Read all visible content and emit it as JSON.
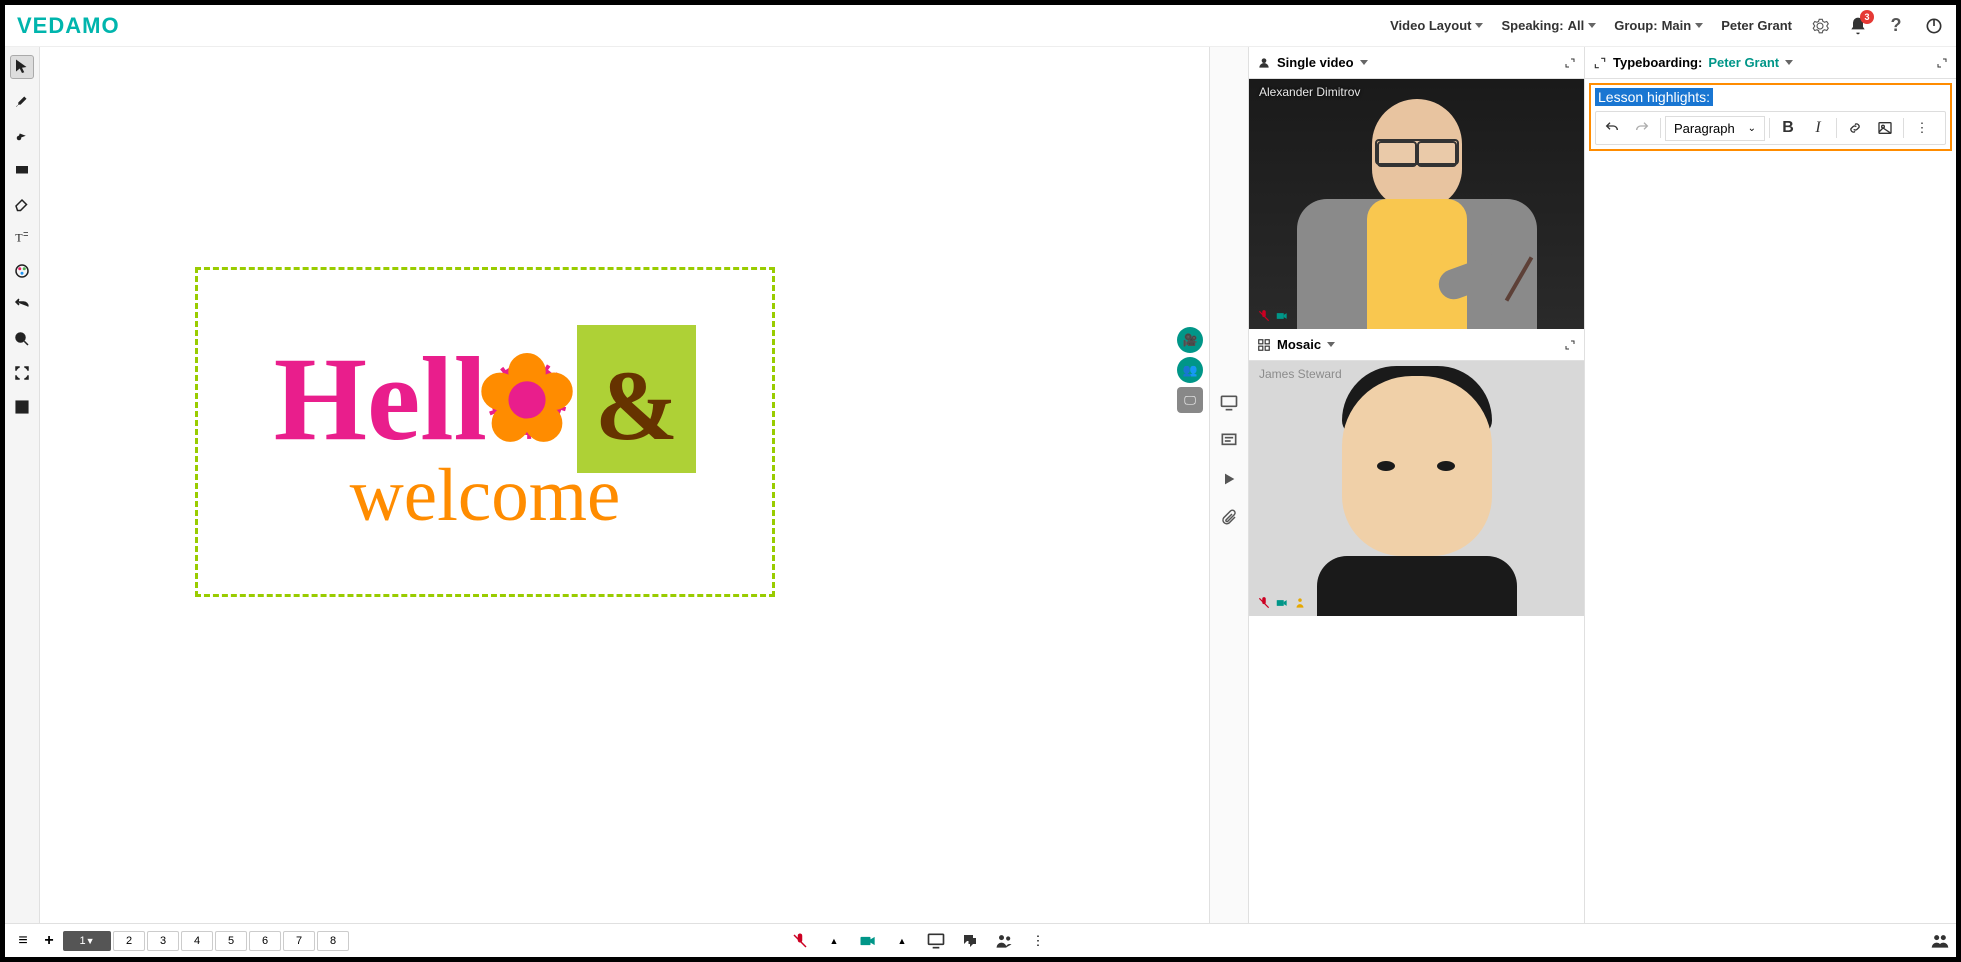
{
  "app": {
    "logo": "VEDAMO"
  },
  "header": {
    "video_layout": "Video Layout",
    "speaking_label": "Speaking:",
    "speaking_value": "All",
    "group_label": "Group:",
    "group_value": "Main",
    "user": "Peter Grant",
    "notification_count": "3"
  },
  "whiteboard": {
    "hello": "Hello",
    "amp": "&",
    "welcome": "welcome"
  },
  "pages": [
    "1",
    "2",
    "3",
    "4",
    "5",
    "6",
    "7",
    "8"
  ],
  "video": {
    "mode1_label": "Single video",
    "participant1": "Alexander Dimitrov",
    "mode2_label": "Mosaic",
    "participant2": "James Steward"
  },
  "typeboard": {
    "label": "Typeboarding:",
    "user": "Peter Grant",
    "content": "Lesson highlights:",
    "format": "Paragraph"
  }
}
